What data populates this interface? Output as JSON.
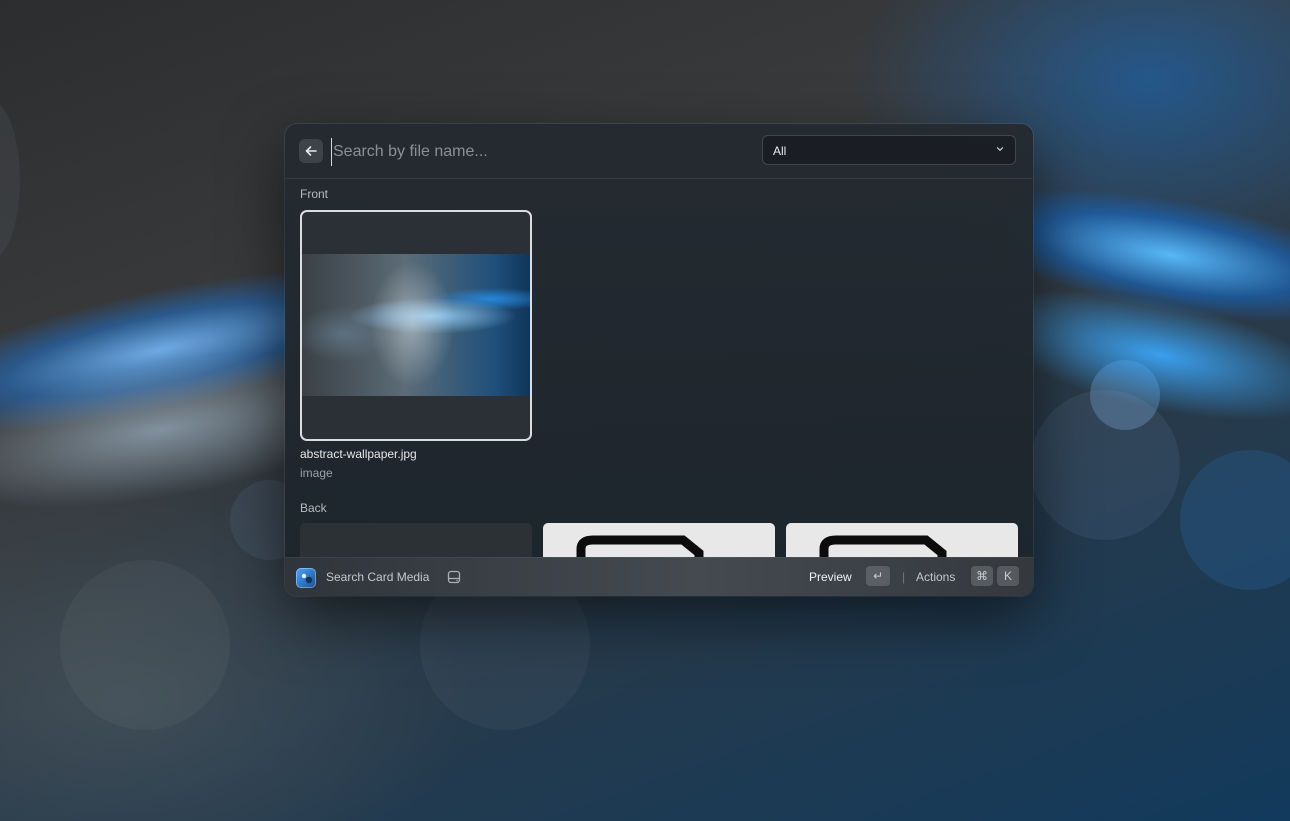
{
  "search": {
    "placeholder": "Search by file name..."
  },
  "filter": {
    "selected": "All"
  },
  "sections": {
    "front": {
      "label": "Front",
      "items": [
        {
          "name": "abstract-wallpaper.jpg",
          "type": "image"
        }
      ]
    },
    "back": {
      "label": "Back"
    }
  },
  "bottom_bar": {
    "title": "Search Card Media",
    "preview_label": "Preview",
    "preview_key": "↵",
    "actions_label": "Actions",
    "actions_keys": [
      "⌘",
      "K"
    ]
  },
  "icons": {
    "back": "arrow-left-icon",
    "chevron": "chevron-down-icon",
    "extension": "extension-icon",
    "drive": "hard-drive-icon"
  },
  "colors": {
    "accent": "#2f7fd6",
    "panel": "#242a30"
  }
}
